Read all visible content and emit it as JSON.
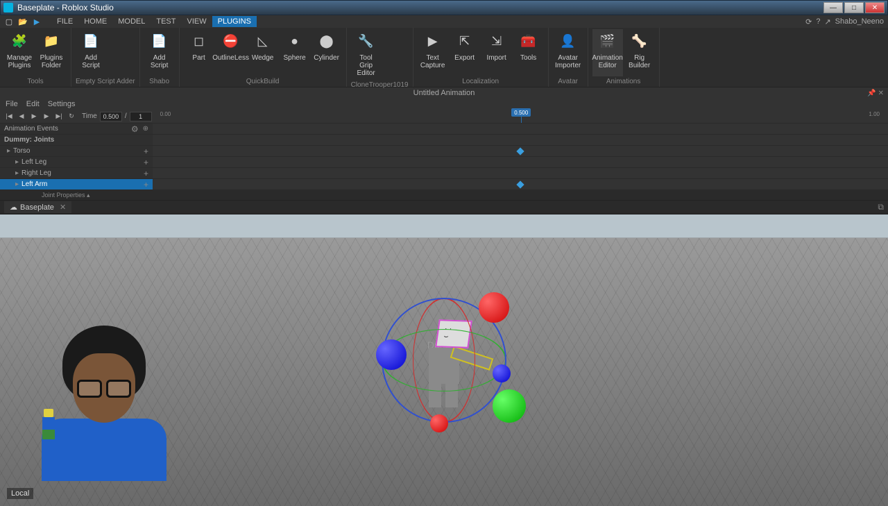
{
  "titlebar": {
    "title": "Baseplate - Roblox Studio"
  },
  "user": "Shabo_Neeno",
  "menutabs": [
    "FILE",
    "HOME",
    "MODEL",
    "TEST",
    "VIEW",
    "PLUGINS"
  ],
  "menutab_active": 5,
  "ribbon": {
    "groups": [
      {
        "label": "Tools",
        "buttons": [
          {
            "t": "Manage Plugins",
            "i": "🧩"
          },
          {
            "t": "Plugins Folder",
            "i": "📁"
          }
        ]
      },
      {
        "label": "Empty Script Adder",
        "buttons": [
          {
            "t": "Add Script",
            "i": "📄"
          }
        ]
      },
      {
        "label": "Shabo",
        "buttons": [
          {
            "t": "Add Script",
            "i": "📄"
          }
        ]
      },
      {
        "label": "QuickBuild",
        "buttons": [
          {
            "t": "Part",
            "i": "◻"
          },
          {
            "t": "OutlineLess",
            "i": "⛔"
          },
          {
            "t": "Wedge",
            "i": "◺"
          },
          {
            "t": "Sphere",
            "i": "●"
          },
          {
            "t": "Cylinder",
            "i": "⬤"
          }
        ]
      },
      {
        "label": "CloneTrooper1019",
        "buttons": [
          {
            "t": "Tool Grip Editor",
            "i": "🔧"
          }
        ]
      },
      {
        "label": "Localization",
        "buttons": [
          {
            "t": "Text Capture",
            "i": "▶"
          },
          {
            "t": "Export",
            "i": "⇱"
          },
          {
            "t": "Import",
            "i": "⇲"
          },
          {
            "t": "Tools",
            "i": "🧰"
          }
        ]
      },
      {
        "label": "Avatar",
        "buttons": [
          {
            "t": "Avatar Importer",
            "i": "👤"
          }
        ]
      },
      {
        "label": "Animations",
        "buttons": [
          {
            "t": "Animation Editor",
            "i": "🎬",
            "sel": true
          },
          {
            "t": "Rig Builder",
            "i": "🦴"
          }
        ]
      }
    ]
  },
  "anim": {
    "title": "Untitled Animation",
    "menu": [
      "File",
      "Edit",
      "Settings"
    ],
    "time": "0.500",
    "total": "1",
    "ruler_start": "0.00",
    "ruler_end": "1.00",
    "playhead": "0.500",
    "playhead_pct": 50,
    "events_label": "Animation Events",
    "root": "Dummy: Joints",
    "joints": [
      {
        "name": "Torso",
        "key": true
      },
      {
        "name": "Left Leg"
      },
      {
        "name": "Right Leg"
      },
      {
        "name": "Left Arm",
        "sel": true,
        "key": true
      }
    ],
    "joint_props": "Joint Properties  ▴"
  },
  "doctab": {
    "name": "Baseplate"
  },
  "viewport": {
    "char_name": "Dummy",
    "local": "Local"
  }
}
